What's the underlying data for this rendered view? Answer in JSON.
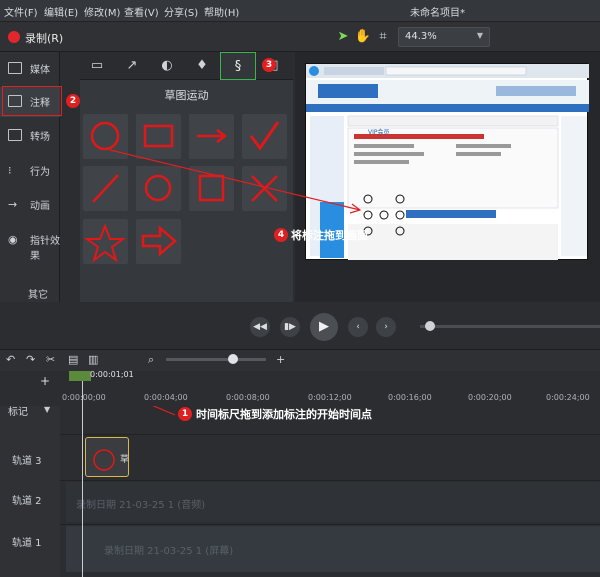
{
  "menu": [
    "文件(F)",
    "编辑(E)",
    "修改(M)",
    "查看(V)",
    "分享(S)",
    "帮助(H)"
  ],
  "app_title": "未命名项目*",
  "toolbar": {
    "record_label": "录制(R)",
    "zoom": "44.3%"
  },
  "left_panel": {
    "items": [
      "媒体",
      "注释",
      "转场",
      "行为",
      "动画",
      "指针效果"
    ],
    "more": "其它"
  },
  "sketch": {
    "title": "草图运动"
  },
  "preview": {
    "toolbar_url": "http://www.leawo.com/",
    "heading": "VIP会员",
    "banner": "陪伴您",
    "tab1": "软件学堂",
    "tab2": "日常一些"
  },
  "timeline": {
    "time": "0:00:01;01",
    "ticks": [
      "0:00:00;00",
      "0:00:04;00",
      "0:00:08;00",
      "0:00:12;00",
      "0:00:16;00",
      "0:00:20;00",
      "0:00:24;00"
    ],
    "marker": "标记",
    "tracks": [
      "轨道 3",
      "轨道 2",
      "轨道 1"
    ],
    "audio_clip": "录制日期 21-03-25 1 (音频)",
    "screen_clip": "录制日期 21-03-25 1 (屏幕)",
    "annot_clip": "草"
  },
  "callouts": {
    "c2": "2",
    "c3": "3",
    "c4": "将标注拖到画面",
    "c4n": "4",
    "c1": "时间标尺拖到添加标注的开始时间点",
    "c1n": "1"
  },
  "colors": {
    "accent": "#e02020",
    "green": "#3cb44a"
  }
}
